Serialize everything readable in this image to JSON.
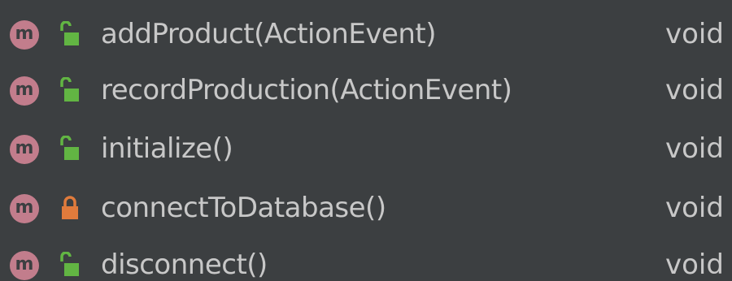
{
  "members": [
    {
      "method_icon": "m",
      "visibility": "public",
      "lock_icon": "unlocked-lock-icon",
      "signature": "addProduct(ActionEvent)",
      "return_type": "void"
    },
    {
      "method_icon": "m",
      "visibility": "public",
      "lock_icon": "unlocked-lock-icon",
      "signature": "recordProduction(ActionEvent)",
      "return_type": "void"
    },
    {
      "method_icon": "m",
      "visibility": "public",
      "lock_icon": "unlocked-lock-icon",
      "signature": "initialize()",
      "return_type": "void"
    },
    {
      "method_icon": "m",
      "visibility": "private",
      "lock_icon": "locked-lock-icon",
      "signature": "connectToDatabase()",
      "return_type": "void"
    },
    {
      "method_icon": "m",
      "visibility": "public",
      "lock_icon": "unlocked-lock-icon",
      "signature": "disconnect()",
      "return_type": "void"
    }
  ],
  "colors": {
    "background": "#3c3f41",
    "method_badge": "#c27d8c",
    "public_lock": "#62b543",
    "private_lock": "#e07b3c",
    "text": "#c8c8c8"
  }
}
